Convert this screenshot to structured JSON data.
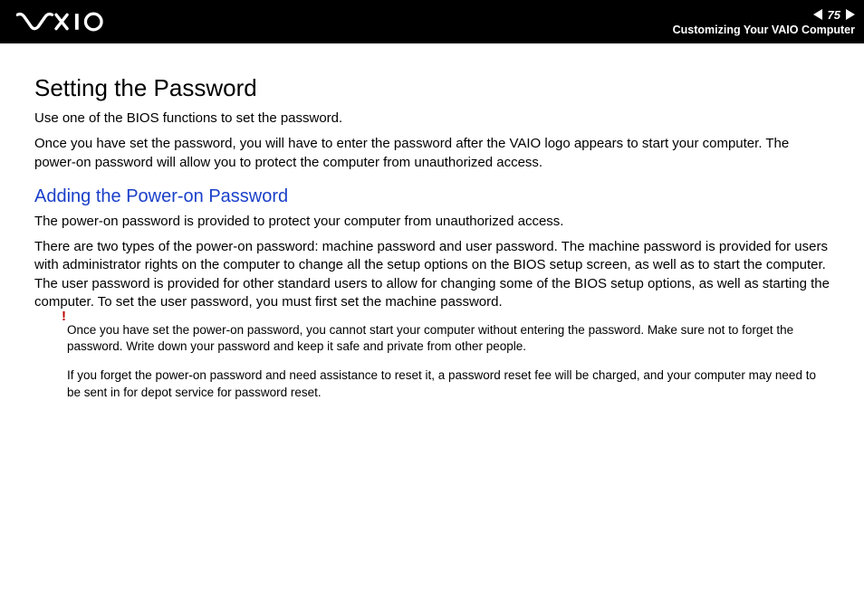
{
  "header": {
    "page_number": "75",
    "breadcrumb": "Customizing Your VAIO Computer"
  },
  "h1": "Setting the Password",
  "intro1": "Use one of the BIOS functions to set the password.",
  "intro2": "Once you have set the password, you will have to enter the password after the VAIO logo appears to start your computer. The power-on password will allow you to protect the computer from unauthorized access.",
  "h2": "Adding the Power-on Password",
  "p1": "The power-on password is provided to protect your computer from unauthorized access.",
  "p2": "There are two types of the power-on password: machine password and user password. The machine password is provided for users with administrator rights on the computer to change all the setup options on the BIOS setup screen, as well as to start the computer. The user password is provided for other standard users to allow for changing some of the BIOS setup options, as well as starting the computer. To set the user password, you must first set the machine password.",
  "note_mark": "!",
  "note1": "Once you have set the power-on password, you cannot start your computer without entering the password. Make sure not to forget the password. Write down your password and keep it safe and private from other people.",
  "note2": "If you forget the power-on password and need assistance to reset it, a password reset fee will be charged, and your computer may need to be sent in for depot service for password reset."
}
